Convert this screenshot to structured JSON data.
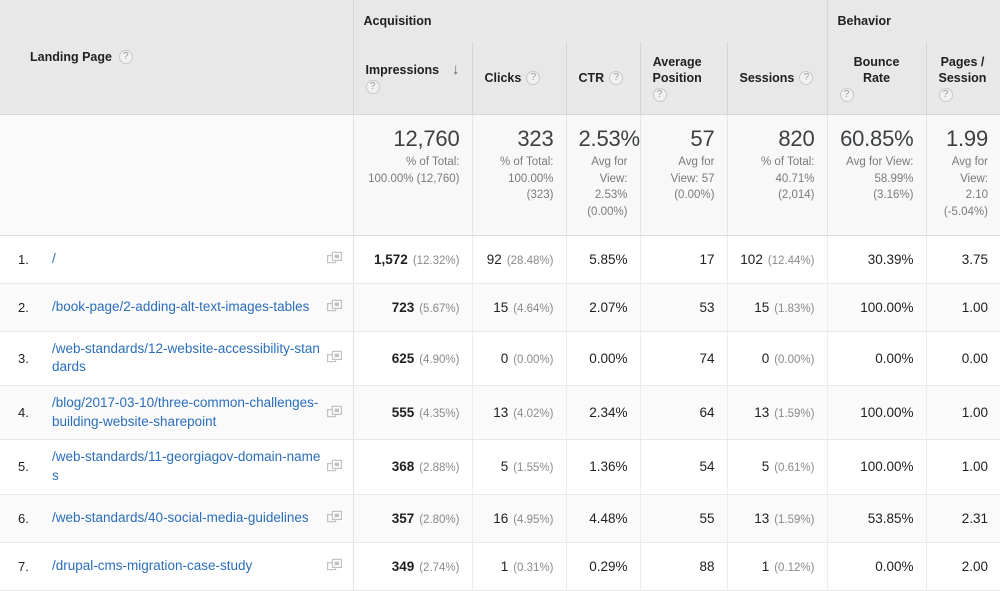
{
  "table": {
    "groups": [
      {
        "label": "",
        "name": "group-dimension"
      },
      {
        "label": "Acquisition",
        "name": "group-acquisition"
      },
      {
        "label": "Behavior",
        "name": "group-behavior"
      }
    ],
    "dimension_header": {
      "label": "Landing Page",
      "help_icon": "help-circle-icon",
      "help_glyph": "?"
    },
    "columns": [
      {
        "label": "Impressions",
        "name": "column-impressions",
        "sorted": true,
        "sort_glyph": "↓",
        "help_glyph": "?",
        "wrap": true
      },
      {
        "label": "Clicks",
        "name": "column-clicks",
        "sorted": false,
        "help_glyph": "?",
        "wrap": false
      },
      {
        "label": "CTR",
        "name": "column-ctr",
        "sorted": false,
        "help_glyph": "?",
        "wrap": false
      },
      {
        "label": "Average\nPosition",
        "name": "column-average-position",
        "sorted": false,
        "help_glyph": "?",
        "wrap": true
      },
      {
        "label": "Sessions",
        "name": "column-sessions",
        "sorted": false,
        "help_glyph": "?",
        "wrap": false
      },
      {
        "label": "Bounce Rate",
        "name": "column-bounce-rate",
        "sorted": false,
        "help_glyph": "?",
        "wrap": true
      },
      {
        "label": "Pages /\nSession",
        "name": "column-pages-session",
        "sorted": false,
        "help_glyph": "?",
        "wrap": true
      }
    ],
    "summary": {
      "impressions": {
        "value": "12,760",
        "sub": "% of Total:\n100.00% (12,760)"
      },
      "clicks": {
        "value": "323",
        "sub": "% of Total:\n100.00%\n(323)"
      },
      "ctr": {
        "value": "2.53%",
        "sub": "Avg for\nView:\n2.53%\n(0.00%)"
      },
      "average_position": {
        "value": "57",
        "sub": "Avg for\nView: 57\n(0.00%)"
      },
      "sessions": {
        "value": "820",
        "sub": "% of Total:\n40.71%\n(2,014)"
      },
      "bounce_rate": {
        "value": "60.85%",
        "sub": "Avg for View:\n58.99%\n(3.16%)"
      },
      "pages_session": {
        "value": "1.99",
        "sub": "Avg for\nView:\n2.10\n(-5.04%)"
      }
    },
    "rows": [
      {
        "index": "1.",
        "landing_page": "/",
        "open_icon": "open-in-new-icon",
        "impressions": "1,572",
        "impressions_pct": "(12.32%)",
        "clicks": "92",
        "clicks_pct": "(28.48%)",
        "ctr": "5.85%",
        "average_position": "17",
        "sessions": "102",
        "sessions_pct": "(12.44%)",
        "bounce_rate": "30.39%",
        "pages_session": "3.75"
      },
      {
        "index": "2.",
        "landing_page": "/book-page/2-adding-alt-text-images-tables",
        "open_icon": "open-in-new-icon",
        "impressions": "723",
        "impressions_pct": "(5.67%)",
        "clicks": "15",
        "clicks_pct": "(4.64%)",
        "ctr": "2.07%",
        "average_position": "53",
        "sessions": "15",
        "sessions_pct": "(1.83%)",
        "bounce_rate": "100.00%",
        "pages_session": "1.00"
      },
      {
        "index": "3.",
        "landing_page": "/web-standards/12-website-accessibility-standards",
        "open_icon": "open-in-new-icon",
        "impressions": "625",
        "impressions_pct": "(4.90%)",
        "clicks": "0",
        "clicks_pct": "(0.00%)",
        "ctr": "0.00%",
        "average_position": "74",
        "sessions": "0",
        "sessions_pct": "(0.00%)",
        "bounce_rate": "0.00%",
        "pages_session": "0.00"
      },
      {
        "index": "4.",
        "landing_page": "/blog/2017-03-10/three-common-challenges-building-website-sharepoint",
        "open_icon": "open-in-new-icon",
        "impressions": "555",
        "impressions_pct": "(4.35%)",
        "clicks": "13",
        "clicks_pct": "(4.02%)",
        "ctr": "2.34%",
        "average_position": "64",
        "sessions": "13",
        "sessions_pct": "(1.59%)",
        "bounce_rate": "100.00%",
        "pages_session": "1.00"
      },
      {
        "index": "5.",
        "landing_page": "/web-standards/11-georgiagov-domain-names",
        "open_icon": "open-in-new-icon",
        "impressions": "368",
        "impressions_pct": "(2.88%)",
        "clicks": "5",
        "clicks_pct": "(1.55%)",
        "ctr": "1.36%",
        "average_position": "54",
        "sessions": "5",
        "sessions_pct": "(0.61%)",
        "bounce_rate": "100.00%",
        "pages_session": "1.00"
      },
      {
        "index": "6.",
        "landing_page": "/web-standards/40-social-media-guidelines",
        "open_icon": "open-in-new-icon",
        "impressions": "357",
        "impressions_pct": "(2.80%)",
        "clicks": "16",
        "clicks_pct": "(4.95%)",
        "ctr": "4.48%",
        "average_position": "55",
        "sessions": "13",
        "sessions_pct": "(1.59%)",
        "bounce_rate": "53.85%",
        "pages_session": "2.31"
      },
      {
        "index": "7.",
        "landing_page": "/drupal-cms-migration-case-study",
        "open_icon": "open-in-new-icon",
        "impressions": "349",
        "impressions_pct": "(2.74%)",
        "clicks": "1",
        "clicks_pct": "(0.31%)",
        "ctr": "0.29%",
        "average_position": "88",
        "sessions": "1",
        "sessions_pct": "(0.12%)",
        "bounce_rate": "0.00%",
        "pages_session": "2.00"
      }
    ]
  },
  "colors": {
    "header_bg": "#e8e8e8",
    "link": "#2a6ebb",
    "row_alt_bg": "#fafafa",
    "muted_text": "#8a8a8a"
  }
}
